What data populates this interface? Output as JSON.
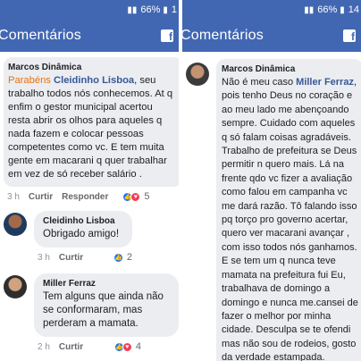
{
  "left": {
    "status": {
      "battery": "66%",
      "time": "1"
    },
    "header": {
      "title": "Comentários",
      "fb_icon": "f"
    },
    "comments": [
      {
        "author": "Marcos Dinâmica",
        "congrats": "Parabéns",
        "mention": "Cleidinho Lisboa",
        "text": ", seu trabalho todos nós conhecemos.  At q enfim o gestor municipal  acertou resta abrir os olhos para aqueles q nada fazem e colocar pessoas competentes como vc. E tem muita gente em macarani q quer trabalhar em vez de só receber salário .",
        "time": "3 h",
        "like": "Curtir",
        "reply": "Responder",
        "reactions": "5"
      },
      {
        "author": "Cleidinho Lisboa",
        "text": "Obrigado amigo!",
        "time": "3 h",
        "like": "Curtir",
        "reactions": "2"
      },
      {
        "author": "Miller Ferraz",
        "text": "Tem alguns que ainda não se conformaram, mas perderam a mamata.",
        "time": "2 h",
        "like": "Curtir",
        "reactions": "4"
      }
    ]
  },
  "right": {
    "status": {
      "battery": "66%",
      "time": "14"
    },
    "header": {
      "title": "Comentários",
      "fb_icon": "f"
    },
    "comment": {
      "author": "Marcos Dinâmica",
      "before": "Não é  meu caso ",
      "mention": "Miller Ferraz",
      "text": ", pois tenho Deus no coração e ao meu lado me abençoando sempre. Cuidado com aqueles q só falam coisas agradáveis. Trabalho de prefeitura se Deus permitir n quero mais. Lá na frente qdo vc fizer a avaliação como falou em campanha vc me dará razão. Tô falando isso pq torço pro governo acertar, quero ver macarani avançar , com isso todos nós ganhamos. E se tem um q nunca teve mamata na prefeitura fui Eu, trabalhava de domingo a domingo e nunca me.cansei de fazer o melhor por minha cidade.  Desculpa se te ofendi mas não sou de rodeios, gosto da verdade estampada."
    }
  },
  "colors": {
    "header": "#4267b2",
    "bubble": "#ebedf0",
    "mention": "#385898",
    "congrats": "#e9710f"
  }
}
